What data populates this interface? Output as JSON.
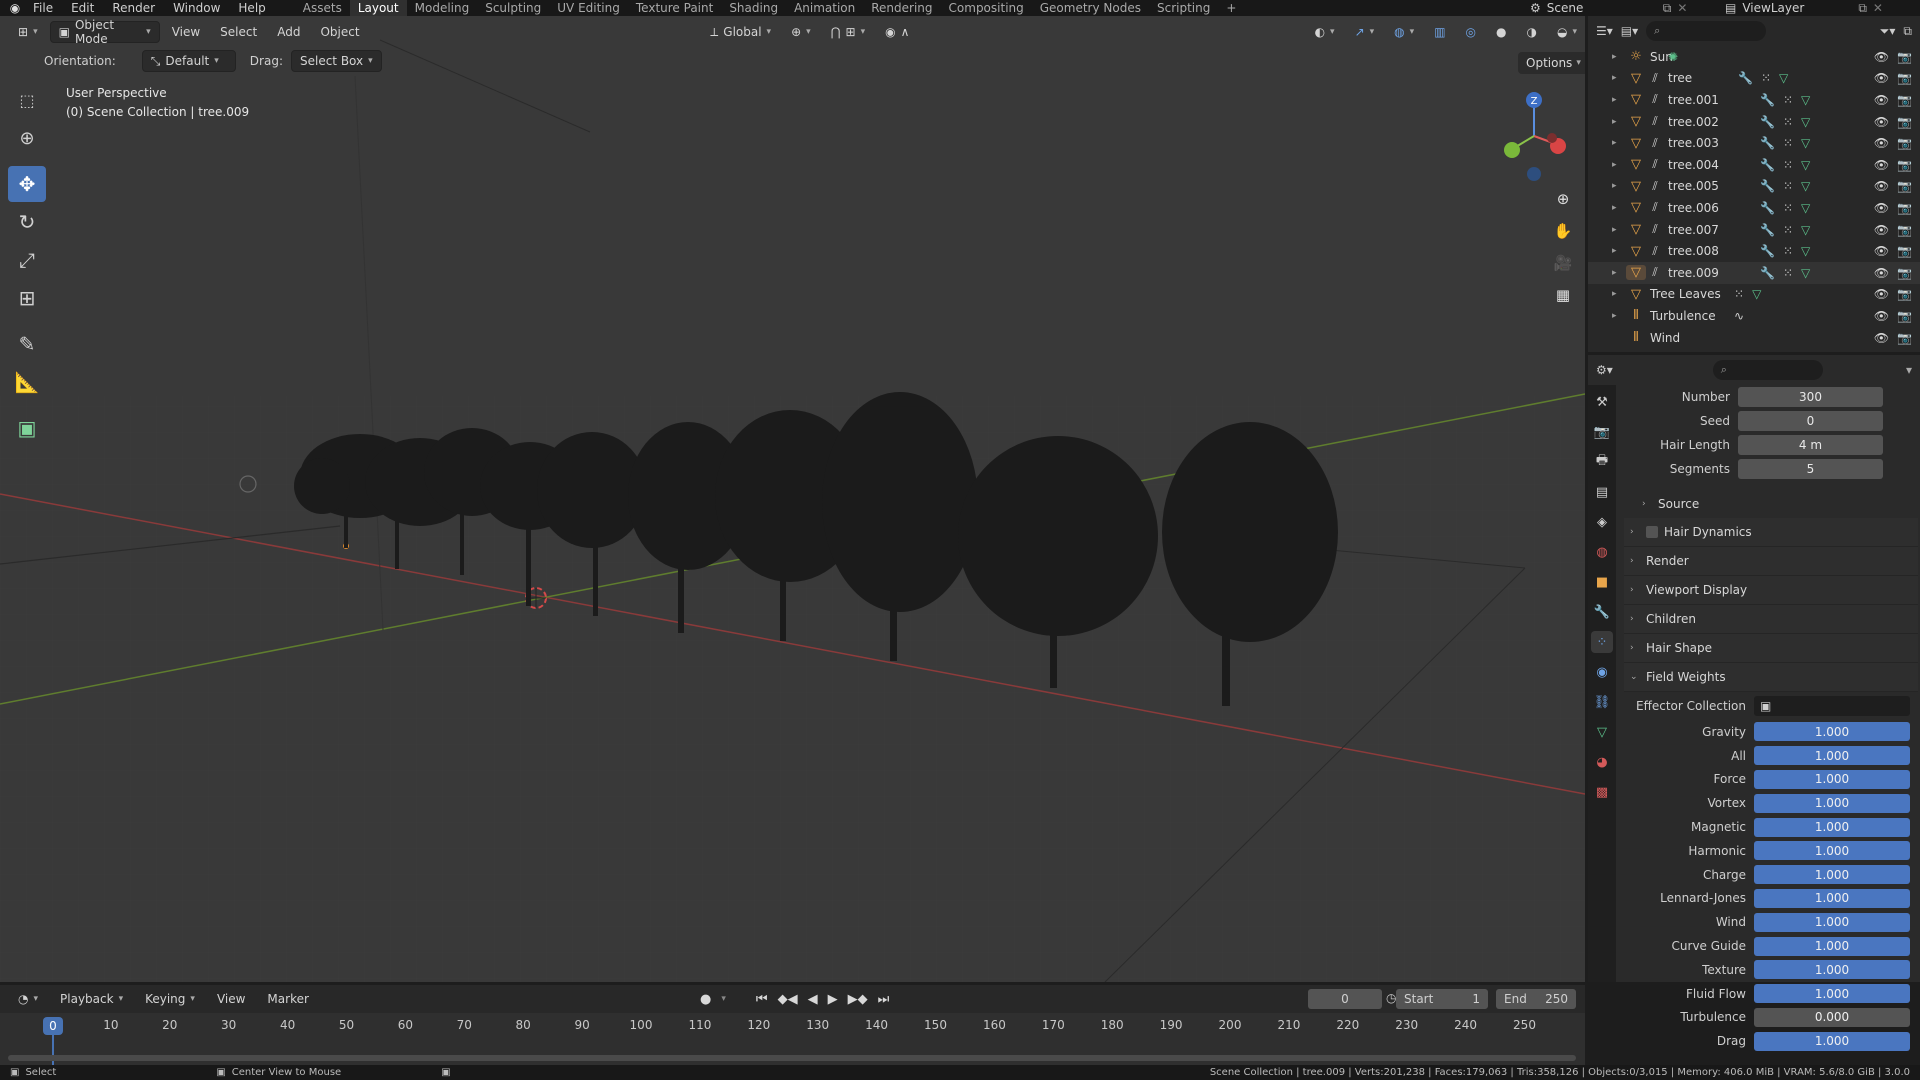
{
  "menubar": {
    "menus": [
      "File",
      "Edit",
      "Render",
      "Window",
      "Help"
    ],
    "workspaces": [
      "Assets",
      "Layout",
      "Modeling",
      "Sculpting",
      "UV Editing",
      "Texture Paint",
      "Shading",
      "Animation",
      "Rendering",
      "Compositing",
      "Geometry Nodes",
      "Scripting"
    ],
    "active_workspace": "Layout",
    "add_tab": "+",
    "scene": "Scene",
    "view_layer": "ViewLayer"
  },
  "viewport": {
    "mode": "Object Mode",
    "menus": [
      "View",
      "Select",
      "Add",
      "Object"
    ],
    "transform_orientation": "Global",
    "orientation_label": "Orientation:",
    "orientation_value": "Default",
    "drag_label": "Drag:",
    "drag_value": "Select Box",
    "options": "Options",
    "view_name": "User Perspective",
    "collection_info": "(0) Scene Collection | tree.009",
    "gizmo_z": "Z"
  },
  "outliner": {
    "search_placeholder": "",
    "items": [
      {
        "name": "Sun",
        "type": "light"
      },
      {
        "name": "tree",
        "type": "mesh"
      },
      {
        "name": "tree.001",
        "type": "mesh"
      },
      {
        "name": "tree.002",
        "type": "mesh"
      },
      {
        "name": "tree.003",
        "type": "mesh"
      },
      {
        "name": "tree.004",
        "type": "mesh"
      },
      {
        "name": "tree.005",
        "type": "mesh"
      },
      {
        "name": "tree.006",
        "type": "mesh"
      },
      {
        "name": "tree.007",
        "type": "mesh"
      },
      {
        "name": "tree.008",
        "type": "mesh"
      },
      {
        "name": "tree.009",
        "type": "mesh"
      },
      {
        "name": "Tree Leaves",
        "type": "mesh"
      },
      {
        "name": "Turbulence",
        "type": "force"
      },
      {
        "name": "Wind",
        "type": "force"
      }
    ]
  },
  "properties": {
    "fields": [
      {
        "label": "Number",
        "value": "300"
      },
      {
        "label": "Seed",
        "value": "0"
      },
      {
        "label": "Hair Length",
        "value": "4 m"
      },
      {
        "label": "Segments",
        "value": "5"
      }
    ],
    "panels": [
      "Source",
      "Hair Dynamics",
      "Render",
      "Viewport Display",
      "Children",
      "Hair Shape",
      "Field Weights"
    ],
    "effector_label": "Effector Collection",
    "weights": [
      {
        "label": "Gravity",
        "value": "1.000"
      },
      {
        "label": "All",
        "value": "1.000"
      },
      {
        "label": "Force",
        "value": "1.000"
      },
      {
        "label": "Vortex",
        "value": "1.000"
      },
      {
        "label": "Magnetic",
        "value": "1.000"
      },
      {
        "label": "Harmonic",
        "value": "1.000"
      },
      {
        "label": "Charge",
        "value": "1.000"
      },
      {
        "label": "Lennard-Jones",
        "value": "1.000"
      },
      {
        "label": "Wind",
        "value": "1.000"
      },
      {
        "label": "Curve Guide",
        "value": "1.000"
      },
      {
        "label": "Texture",
        "value": "1.000"
      },
      {
        "label": "Fluid Flow",
        "value": "1.000"
      },
      {
        "label": "Turbulence",
        "value": "0.000"
      },
      {
        "label": "Drag",
        "value": "1.000"
      }
    ]
  },
  "timeline": {
    "menus": [
      "Playback",
      "Keying",
      "View",
      "Marker"
    ],
    "current_frame": "0",
    "start_label": "Start",
    "start": "1",
    "end_label": "End",
    "end": "250",
    "ticks": [
      "10",
      "20",
      "30",
      "40",
      "50",
      "60",
      "70",
      "80",
      "90",
      "100",
      "110",
      "120",
      "130",
      "140",
      "150",
      "160",
      "170",
      "180",
      "190",
      "200",
      "210",
      "220",
      "230",
      "240",
      "250"
    ],
    "playhead": "0"
  },
  "statusbar": {
    "left": "Select",
    "middle": "Center View to Mouse",
    "right": "Scene Collection | tree.009 | Verts:201,238 | Faces:179,063 | Tris:358,126 | Objects:0/3,015 | Memory: 406.0 MiB | VRAM: 5.6/8.0 GiB | 3.0.0"
  }
}
